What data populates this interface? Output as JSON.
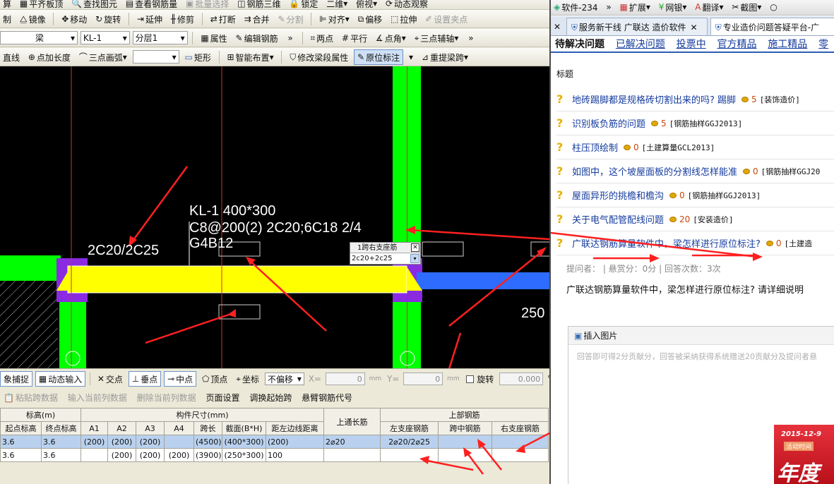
{
  "toolbar1": {
    "items": [
      "算",
      "平齐板顶",
      "查找图元",
      "查看钢筋量",
      "批量选择",
      "钢筋三维",
      "锁定",
      "二维",
      "俯视",
      "动态观察"
    ]
  },
  "toolbar2": {
    "items": [
      "制",
      "镜像",
      "移动",
      "旋转",
      "延伸",
      "修剪",
      "打断",
      "合并",
      "分割",
      "对齐",
      "偏移",
      "拉伸",
      "设置夹点"
    ]
  },
  "toolbar3": {
    "type_value": "梁",
    "member_value": "KL-1",
    "floor_value": "分层1",
    "items": [
      "属性",
      "编辑钢筋",
      "两点",
      "平行",
      "点角",
      "三点辅轴"
    ]
  },
  "toolbar4": {
    "items": [
      "直线",
      "点加长度",
      "三点画弧",
      "矩形",
      "智能布置",
      "修改梁段属性",
      "原位标注",
      "重提梁跨"
    ]
  },
  "canvas": {
    "beam_label_1": "KL-1 400*300",
    "beam_label_2": "C8@200(2) 2C20;6C18 2/4",
    "beam_label_3": "G4B12",
    "support_label": "2C20/2C25",
    "dim_label": "250",
    "popup_title": "1跨右支座筋",
    "popup_value": "2c20+2c25",
    "colors": {
      "beam": "#ffff00",
      "column": "#00ff00",
      "annot": "#ff2020",
      "purple": "#8a2be2",
      "blue": "#2d6cff"
    }
  },
  "statusbar": {
    "items": [
      "象捕捉",
      "动态输入",
      "交点",
      "垂点",
      "中点",
      "顶点",
      "坐标"
    ],
    "offset_select": "不偏移",
    "x_label": "X=",
    "x_value": "0",
    "y_label": "Y=",
    "y_value": "0",
    "unit": "mm",
    "rotate_label": "旋转",
    "rotate_value": "0.000",
    "degree": "°"
  },
  "gridtb": {
    "items": [
      "粘贴跨数据",
      "输入当前列数据",
      "删除当前列数据",
      "页面设置",
      "调换起始跨",
      "悬臂钢筋代号"
    ]
  },
  "grid": {
    "group_headers": {
      "elev": "标高(m)",
      "size": "构件尺寸(mm)",
      "top": "上部钢筋"
    },
    "headers": [
      "起点标高",
      "终点标高",
      "A1",
      "A2",
      "A3",
      "A4",
      "跨长",
      "截面(B*H)",
      "距左边线距离",
      "上通长筋",
      "左支座钢筋",
      "跨中钢筋",
      "右支座钢筋"
    ],
    "rows": [
      [
        "3.6",
        "3.6",
        "(200)",
        "(200)",
        "(200)",
        "",
        "(4500)",
        "(400*300)",
        "(200)",
        "2⌀20",
        "2⌀20/2⌀25",
        "",
        ""
      ],
      [
        "3.6",
        "3.6",
        "",
        "(200)",
        "(200)",
        "(200)",
        "(3900)",
        "(250*300)",
        "100",
        "",
        "",
        "",
        ""
      ]
    ]
  },
  "browser": {
    "top_items": [
      "软件-234",
      "扩展",
      "网银",
      "翻译",
      "截图"
    ],
    "tabs": [
      "服务新干线 广联达 造价软件",
      "专业造价问题答疑平台-广"
    ],
    "qnav": [
      "待解决问题",
      "已解决问题",
      "投票中",
      "官方精品",
      "施工精品",
      "零"
    ],
    "col_title": "标题",
    "questions": [
      {
        "title": "地砖踢脚都是规格砖切割出来的吗? 踢脚",
        "points": "5",
        "cat": "[装饰造价]"
      },
      {
        "title": "识别板负筋的问题",
        "points": "5",
        "cat": "[钢筋抽样GGJ2013]"
      },
      {
        "title": "柱压顶绘制",
        "points": "0",
        "cat": "[土建算量GCL2013]"
      },
      {
        "title": "如图中，这个坡屋面板的分割线怎样能准",
        "points": "0",
        "cat": "[钢筋抽样GGJ20"
      },
      {
        "title": "屋面异形的挑檐和檐沟",
        "points": "0",
        "cat": "[钢筋抽样GGJ2013]"
      },
      {
        "title": "关于电气配管配线问题",
        "points": "20",
        "cat": "[安装造价]"
      },
      {
        "title": "广联达钢筋算量软件中，梁怎样进行原位标注?",
        "points": "0",
        "cat": "[土建造"
      }
    ],
    "meta": "提问者：   |  悬赏分：0分  |  回答次数：3次",
    "question_body": "广联达钢筋算量软件中，梁怎样进行原位标注? 请详细说明",
    "insert_image": "插入图片",
    "placeholder": "回答即可得2分贡献分，回答被采纳获得系统赠送20贡献分及提问者悬",
    "ad_date": "2015-12-9",
    "ad_sub": "活动时间",
    "ad_big": "年度"
  }
}
